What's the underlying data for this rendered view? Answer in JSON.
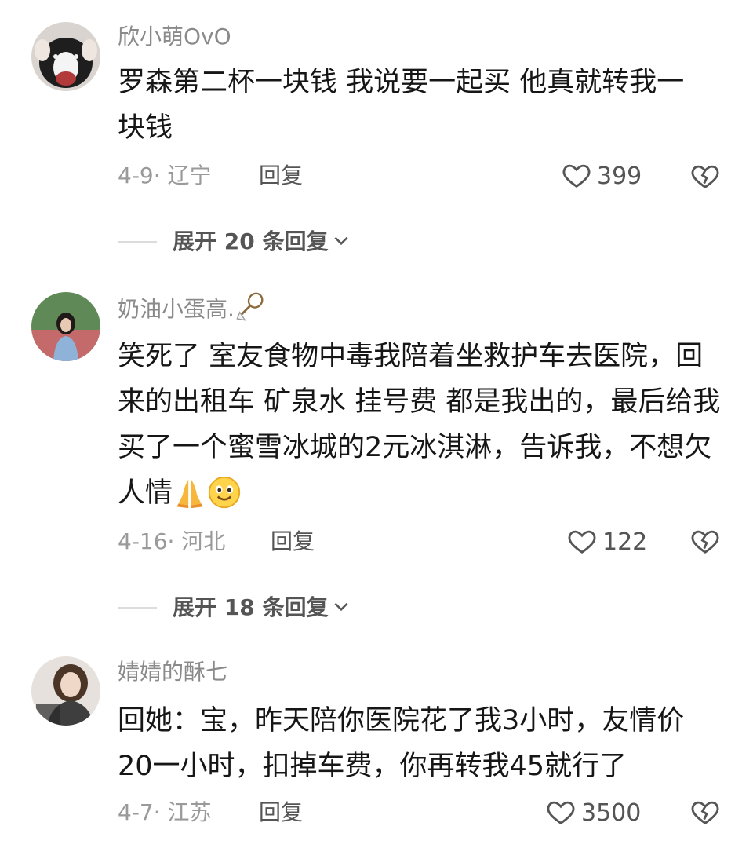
{
  "comments": [
    {
      "username": "欣小萌OvO",
      "text": "罗森第二杯一块钱 我说要一起买 他真就转我一块钱",
      "meta": "4-9· 辽宁",
      "reply_label": "回复",
      "likes": "399",
      "expand_label": "展开 20 条回复"
    },
    {
      "username": "奶油小蛋高.",
      "username_emoji": "badminton-icon",
      "text": "笑死了 室友食物中毒我陪着坐救护车去医院，回来的出租车 矿泉水 挂号费 都是我出的，最后给我买了一个蜜雪冰城的2元冰淇淋，告诉我，不想欠人情",
      "text_emojis": [
        "pray-emoji",
        "smile-emoji"
      ],
      "meta": "4-16· 河北",
      "reply_label": "回复",
      "likes": "122",
      "expand_label": "展开 18 条回复"
    },
    {
      "username": "婧婧的酥七",
      "text": "回她：宝，昨天陪你医院花了我3小时，友情价20一小时，扣掉车费，你再转我45就行了",
      "meta": "4-7· 江苏",
      "reply_label": "回复",
      "likes": "3500"
    }
  ],
  "colors": {
    "username": "#8a8a8a",
    "text": "#161616",
    "meta": "#9a9a9a",
    "action": "#555555"
  }
}
